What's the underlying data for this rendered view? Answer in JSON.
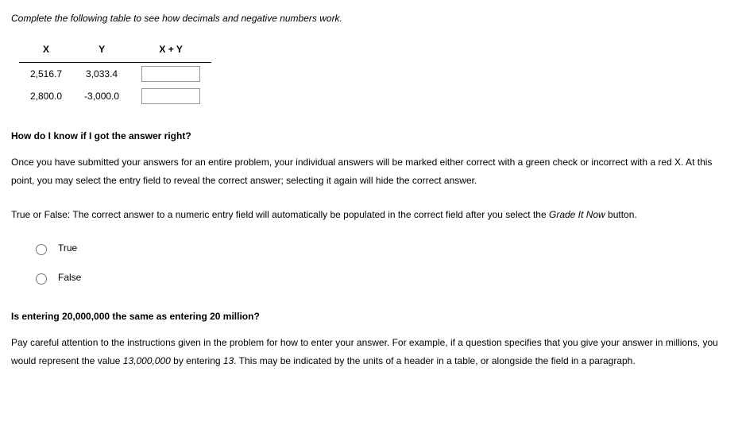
{
  "instruction": "Complete the following table to see how decimals and negative numbers work.",
  "table": {
    "headers": {
      "x": "X",
      "y": "Y",
      "sum": "X + Y"
    },
    "rows": [
      {
        "x": "2,516.7",
        "y": "3,033.4",
        "sum": ""
      },
      {
        "x": "2,800.0",
        "y": "-3,000.0",
        "sum": ""
      }
    ]
  },
  "section1": {
    "heading": "How do I know if I got the answer right?",
    "body": "Once you have submitted your answers for an entire problem, your individual answers will be marked either correct with a green check or incorrect with a red X. At this point, you may select the entry field to reveal the correct answer; selecting it again will hide the correct answer."
  },
  "tf_question": {
    "prefix": "True or False: The correct answer to a numeric entry field will automatically be populated in the correct field after you select the ",
    "italic": "Grade It Now",
    "suffix": " button.",
    "options": {
      "true": "True",
      "false": "False"
    }
  },
  "section2": {
    "heading": "Is entering 20,000,000 the same as entering 20 million?",
    "body_prefix": "Pay careful attention to the instructions given in the problem for how to enter your answer. For example, if a question specifies that you give your answer in millions, you would represent the value ",
    "body_italic": "13,000,000",
    "body_middle": " by entering ",
    "body_italic2": "13",
    "body_suffix": ". This may be indicated by the units of a header in a table, or alongside the field in a paragraph."
  }
}
